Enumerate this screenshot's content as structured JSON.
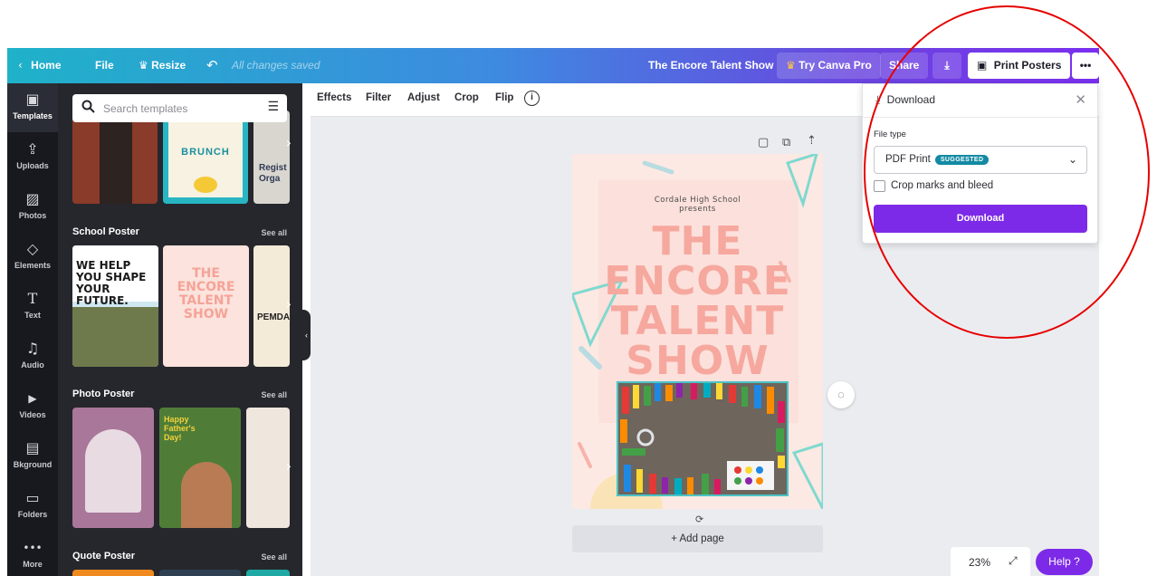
{
  "topbar": {
    "home_label": "Home",
    "file_label": "File",
    "resize_label": "Resize",
    "saved_status": "All changes saved",
    "design_title": "The Encore Talent Show",
    "try_pro_label": "Try Canva Pro",
    "share_label": "Share",
    "print_label": "Print Posters",
    "more_label": "•••"
  },
  "rail": {
    "items": [
      {
        "label": "Templates",
        "icon": "▣"
      },
      {
        "label": "Uploads",
        "icon": "⇪"
      },
      {
        "label": "Photos",
        "icon": "▨"
      },
      {
        "label": "Elements",
        "icon": "◇"
      },
      {
        "label": "Text",
        "icon": "T"
      },
      {
        "label": "Audio",
        "icon": "♫"
      },
      {
        "label": "Videos",
        "icon": "▶"
      },
      {
        "label": "Bkground",
        "icon": "▤"
      },
      {
        "label": "Folders",
        "icon": "▭"
      },
      {
        "label": "More",
        "icon": "•••"
      }
    ]
  },
  "panel": {
    "search_placeholder": "Search templates",
    "sections": [
      {
        "title": "School Poster",
        "see_all": "See all"
      },
      {
        "title": "Photo Poster",
        "see_all": "See all"
      },
      {
        "title": "Quote Poster",
        "see_all": "See all"
      }
    ],
    "thumb_texts": {
      "brunch": "BRUNCH",
      "regist": "Regist",
      "orgo": "Orga",
      "we_help": "WE HELP YOU SHAPE YOUR FUTURE.",
      "encore_mini": "THE ENCORE TALENT SHOW",
      "pemdas": "PEMDA",
      "happy": "Happy Father's Day!"
    }
  },
  "toolbar": {
    "items": [
      "Effects",
      "Filter",
      "Adjust",
      "Crop",
      "Flip"
    ]
  },
  "poster": {
    "school_line1": "Cordale High School",
    "school_line2": "presents",
    "line1": "THE",
    "line2": "ENCORE",
    "line3": "TALENT",
    "line4": "SHOW"
  },
  "editor": {
    "add_page_label": "+ Add page",
    "zoom_label": "23%",
    "help_label": "Help ?"
  },
  "download_panel": {
    "title": "Download",
    "file_type_label": "File type",
    "selected_type": "PDF Print",
    "badge": "SUGGESTED",
    "crop_label": "Crop marks and bleed",
    "button_label": "Download"
  },
  "colors": {
    "accent": "#7d2ae8",
    "panel_bg": "#26272d",
    "rail_bg": "#18191f",
    "poster_pink": "#f6a89e",
    "annotation": "#e60000"
  }
}
